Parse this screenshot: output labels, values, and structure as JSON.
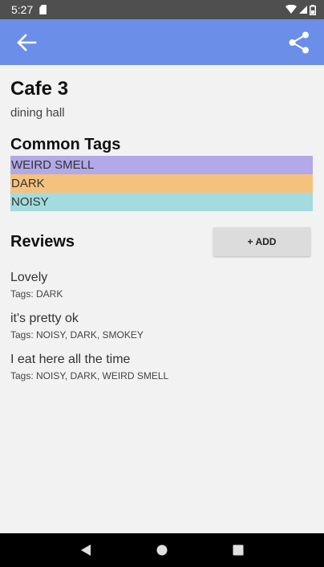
{
  "status_bar": {
    "time": "5:27"
  },
  "app_bar": {
    "back_icon": "arrow-left-icon",
    "share_icon": "share-icon",
    "color": "#6b8ee8"
  },
  "place": {
    "name": "Cafe 3",
    "type": "dining hall"
  },
  "common_tags": {
    "heading": "Common Tags",
    "items": [
      {
        "label": "WEIRD SMELL",
        "color": "#b3a8e8"
      },
      {
        "label": "DARK",
        "color": "#f5c27e"
      },
      {
        "label": "NOISY",
        "color": "#a3dbdf"
      }
    ]
  },
  "reviews": {
    "heading": "Reviews",
    "add_label": "+ ADD",
    "items": [
      {
        "text": "Lovely",
        "tags": "Tags: DARK"
      },
      {
        "text": "it's pretty ok",
        "tags": "Tags: NOISY, DARK, SMOKEY"
      },
      {
        "text": "I eat here all the time",
        "tags": "Tags: NOISY, DARK, WEIRD SMELL"
      }
    ]
  },
  "nav_bar": {
    "back_icon": "triangle-back-icon",
    "home_icon": "circle-home-icon",
    "recents_icon": "square-recents-icon"
  }
}
